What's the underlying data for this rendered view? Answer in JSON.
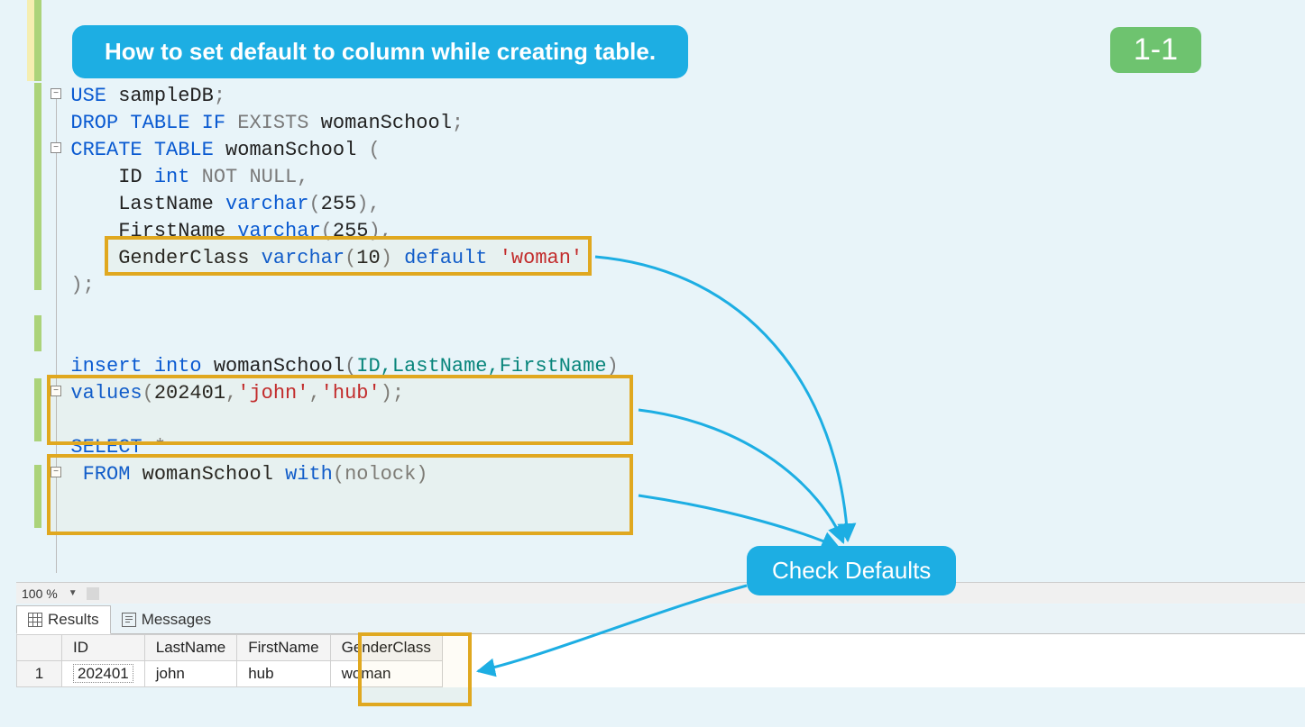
{
  "banner": "How to set default to column while creating table.",
  "step_badge": "1-1",
  "annotation_label": "Check Defaults",
  "zoom": "100 %",
  "code": {
    "l1_use": "USE",
    "l1_db": "sampleDB",
    "l2_drop": "DROP",
    "l2_table": "TABLE",
    "l2_if": "IF",
    "l2_exists": "EXISTS",
    "l2_tbl": "womanSchool",
    "l3_create": "CREATE",
    "l3_table": "TABLE",
    "l3_tbl": "womanSchool",
    "l4_col": "ID",
    "l4_type": "int",
    "l4_not": "NOT",
    "l4_null": "NULL",
    "l5_col": "LastName",
    "l5_type": "varchar",
    "l5_n": "255",
    "l6_col": "FirstName",
    "l6_type": "varchar",
    "l6_n": "255",
    "l7_col": "GenderClass",
    "l7_type": "varchar",
    "l7_n": "10",
    "l7_def": "default",
    "l7_val": "'woman'",
    "l10_ins": "insert",
    "l10_into": "into",
    "l10_tbl": "womanSchool",
    "l10_cols": "ID,LastName,FirstName",
    "l11_values": "values",
    "l11_id": "202401",
    "l11_s1": "'john'",
    "l11_s2": "'hub'",
    "l13_select": "SELECT",
    "l14_from": "FROM",
    "l14_tbl": "womanSchool",
    "l14_with": "with",
    "l14_hint": "nolock"
  },
  "results": {
    "tab_results": "Results",
    "tab_messages": "Messages",
    "columns": [
      "ID",
      "LastName",
      "FirstName",
      "GenderClass"
    ],
    "rows": [
      {
        "n": "1",
        "ID": "202401",
        "LastName": "john",
        "FirstName": "hub",
        "GenderClass": "woman"
      }
    ]
  }
}
